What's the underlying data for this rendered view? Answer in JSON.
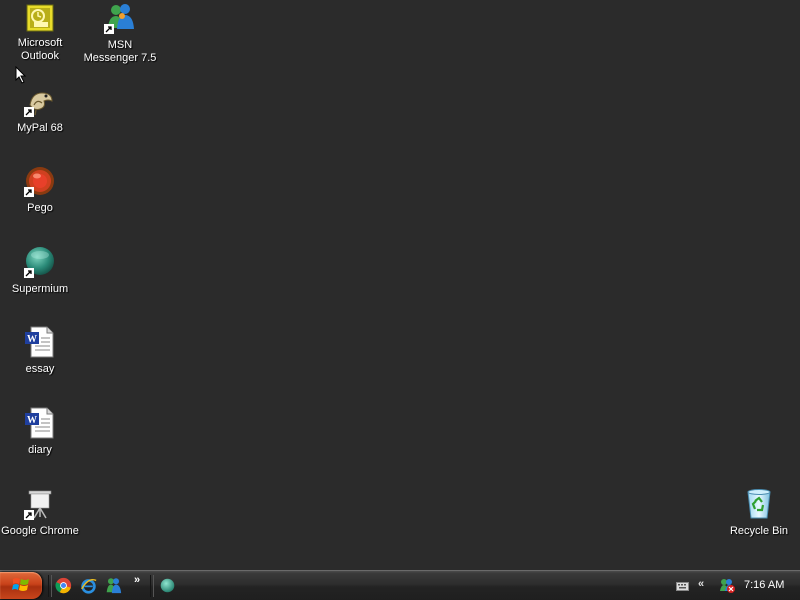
{
  "desktop": {
    "icons": [
      {
        "label": "Microsoft\nOutlook",
        "icon": "outlook-icon",
        "shortcut": false
      },
      {
        "label": "MSN\nMessenger 7.5",
        "icon": "msn-messenger-icon",
        "shortcut": true
      },
      {
        "label": "MyPal 68",
        "icon": "mypal-icon",
        "shortcut": true
      },
      {
        "label": "Pego",
        "icon": "pego-icon",
        "shortcut": true
      },
      {
        "label": "Supermium",
        "icon": "supermium-icon",
        "shortcut": true
      },
      {
        "label": "essay",
        "icon": "word-document-icon",
        "shortcut": false
      },
      {
        "label": "diary",
        "icon": "word-document-icon",
        "shortcut": false
      },
      {
        "label": "Google Chrome",
        "icon": "google-chrome-icon",
        "shortcut": true
      },
      {
        "label": "Recycle Bin",
        "icon": "recycle-bin-icon",
        "shortcut": false
      }
    ]
  },
  "taskbar": {
    "start": {
      "icon": "windows-logo-icon"
    },
    "quick_launch": [
      {
        "icon": "chrome-icon"
      },
      {
        "icon": "internet-explorer-icon"
      },
      {
        "icon": "msn-messenger-icon"
      }
    ],
    "quick_launch_more": "»",
    "tray": {
      "chevron": "«",
      "clock": "7:16 AM"
    }
  },
  "colors": {
    "desktop_background": "#2b2b2b",
    "start_button": "#c9421a"
  }
}
